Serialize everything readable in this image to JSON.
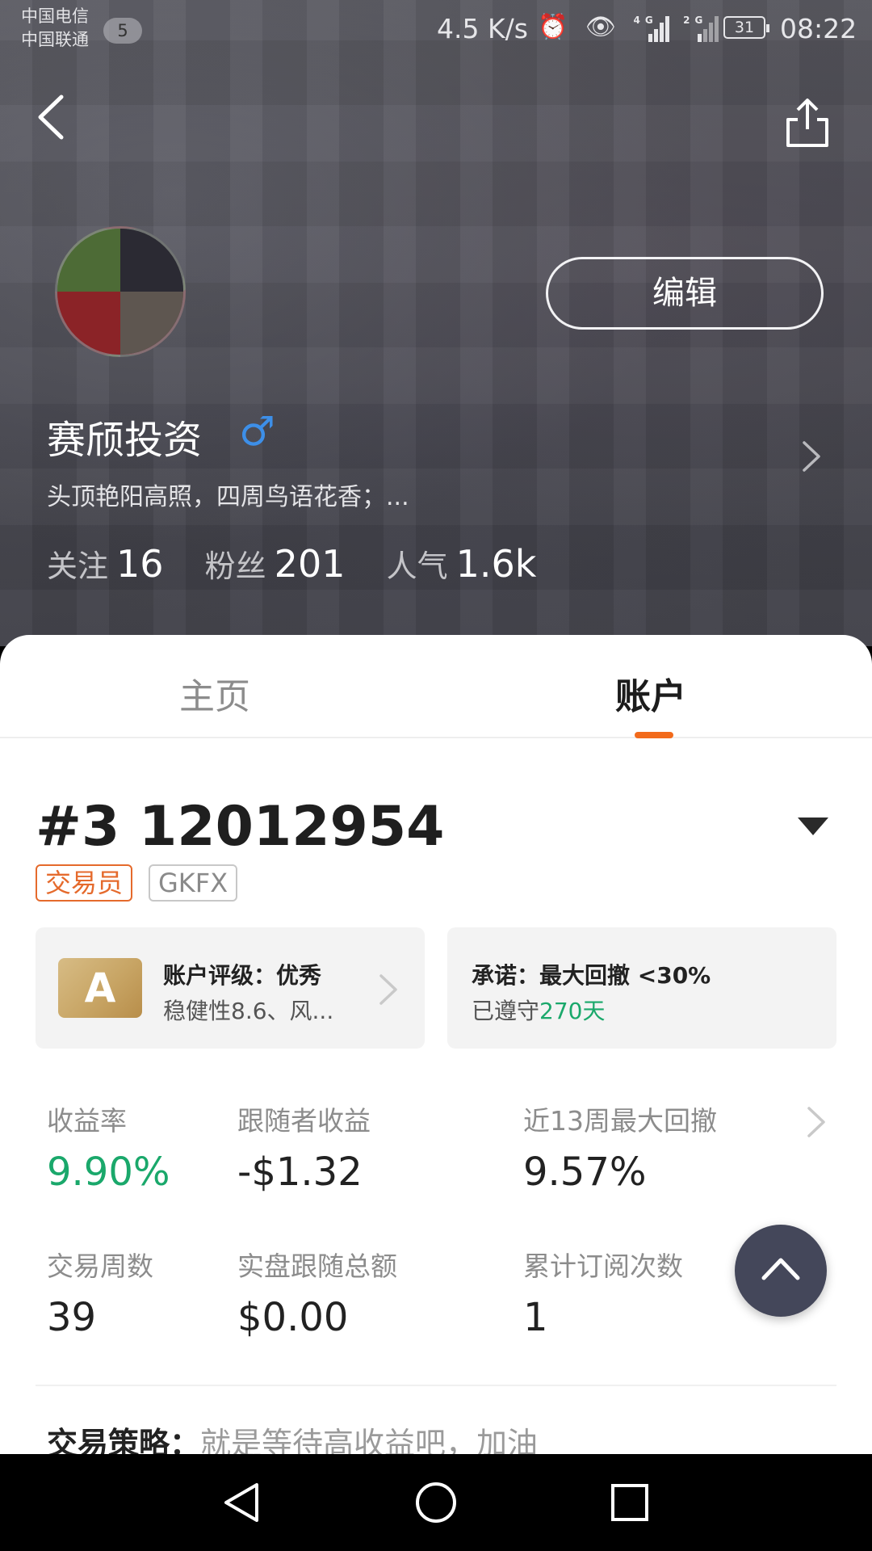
{
  "status_bar": {
    "carrier_1": "中国电信",
    "carrier_2": "中国联通",
    "sim_badge": "5",
    "net_speed": "4.5 K/s",
    "signal_1": "4G",
    "signal_2": "2G",
    "battery": "31",
    "time": "08:22"
  },
  "header": {
    "back_icon": "chevron-left-icon",
    "share_icon": "share-icon",
    "edit_label": "编辑",
    "user_name": "赛颀投资",
    "gender_symbol": "♂",
    "bio": "头顶艳阳高照，四周鸟语花香；...",
    "stats": [
      {
        "label": "关注",
        "value": "16"
      },
      {
        "label": "粉丝",
        "value": "201"
      },
      {
        "label": "人气",
        "value": "1.6k"
      }
    ]
  },
  "tabs": [
    {
      "label": "主页",
      "active": false
    },
    {
      "label": "账户",
      "active": true
    }
  ],
  "account": {
    "title": "#3 12012954",
    "tags": [
      "交易员",
      "GKFX"
    ],
    "rating": {
      "grade": "A",
      "title": "账户评级：优秀",
      "subtitle": "稳健性8.6、风..."
    },
    "promise": {
      "title": "承诺：最大回撤 <30%",
      "prefix": "已遵守",
      "days": "270天"
    },
    "metrics": [
      {
        "label": "收益率",
        "value": "9.90%"
      },
      {
        "label": "跟随者收益",
        "value": "-$1.32"
      },
      {
        "label": "近13周最大回撤",
        "value": "9.57%"
      },
      {
        "label": "交易周数",
        "value": "39"
      },
      {
        "label": "实盘跟随总额",
        "value": "$0.00"
      },
      {
        "label": "累计订阅次数",
        "value": "1"
      }
    ],
    "strategy_label": "交易策略：",
    "strategy_value": "就是等待高收益吧，加油"
  },
  "colors": {
    "accent": "#f26a1b",
    "positive": "#1aa86b",
    "tag_trader": "#e56a2c",
    "gender_blue": "#3d8fe8",
    "fab": "#44475a"
  }
}
